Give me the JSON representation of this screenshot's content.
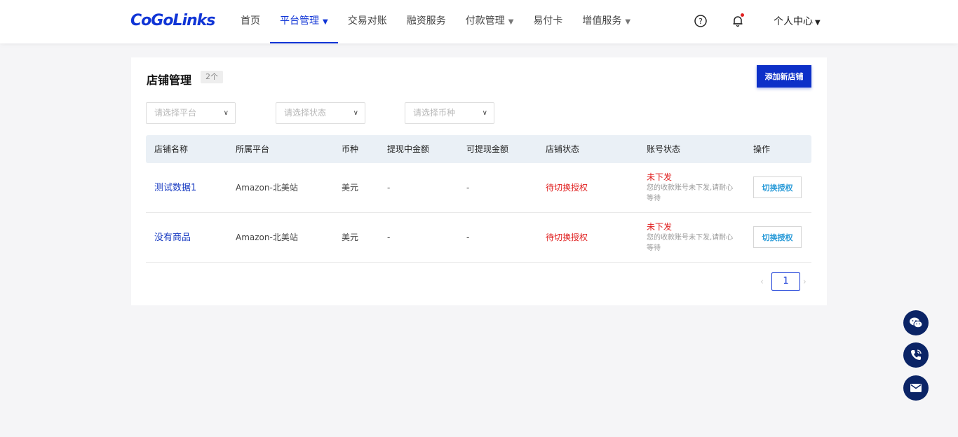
{
  "header": {
    "logo_text": "CoGoLinks",
    "nav": [
      {
        "label": "首页",
        "caret": false
      },
      {
        "label": "平台管理",
        "caret": true,
        "active": true
      },
      {
        "label": "交易对账",
        "caret": false
      },
      {
        "label": "融资服务",
        "caret": false
      },
      {
        "label": "付款管理",
        "caret": true
      },
      {
        "label": "易付卡",
        "caret": false
      },
      {
        "label": "增值服务",
        "caret": true
      }
    ],
    "user_menu": "个人中心",
    "accent_color": "#1035d6"
  },
  "page": {
    "title": "店铺管理",
    "count_badge": "2个",
    "add_button": "添加新店铺",
    "filters": {
      "platform_placeholder": "请选择平台",
      "status_placeholder": "请选择状态",
      "currency_placeholder": "请选择币种"
    }
  },
  "table": {
    "columns": [
      "店铺名称",
      "所属平台",
      "币种",
      "提现中金额",
      "可提现金额",
      "店铺状态",
      "账号状态",
      "操作"
    ],
    "rows": [
      {
        "name": "测试数据1",
        "platform": "Amazon-北美站",
        "currency": "美元",
        "withdrawing": "-",
        "withdrawable": "-",
        "shop_status": "待切换授权",
        "account_status": "未下发",
        "account_tip": "您的收款账号未下发,请耐心等待",
        "action": "切换授权"
      },
      {
        "name": "没有商品",
        "platform": "Amazon-北美站",
        "currency": "美元",
        "withdrawing": "-",
        "withdrawable": "-",
        "shop_status": "待切换授权",
        "account_status": "未下发",
        "account_tip": "您的收款账号未下发,请耐心等待",
        "action": "切换授权"
      }
    ]
  },
  "pagination": {
    "current": "1",
    "prev": "‹",
    "next": "›"
  },
  "floating": [
    "wechat-icon",
    "phone-icon",
    "mail-icon"
  ]
}
